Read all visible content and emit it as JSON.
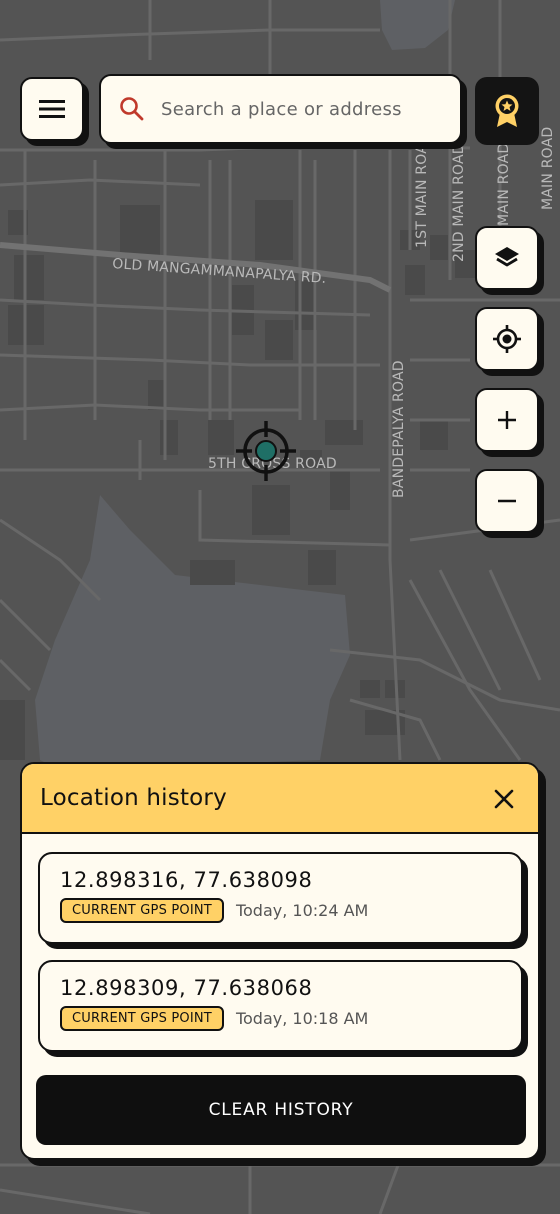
{
  "map": {
    "road_labels": {
      "old_mangammanapalya": "OLD MANGAMMANAPALYA RD.",
      "fifth_cross": "5TH CROSS ROAD",
      "bandepalya": "BANDEPALYA ROAD",
      "first_main": "1ST MAIN ROAD",
      "second_main": "2ND MAIN ROAD",
      "main_road_a": "MAIN ROAD",
      "main_road_b": "MAIN ROAD"
    }
  },
  "search": {
    "placeholder": "Search a place or address"
  },
  "icons": {
    "menu": "hamburger-menu-icon",
    "search": "search-icon",
    "badge": "award-badge-icon",
    "layers": "layers-icon",
    "locate": "locate-target-icon",
    "zoom_in": "plus-icon",
    "zoom_out": "minus-icon",
    "crosshair": "crosshair-icon",
    "close": "close-icon"
  },
  "colors": {
    "accent": "#ffd166",
    "surface": "#fffbf0",
    "ink": "#111111",
    "map_water": "#5e6064",
    "map_land": "#545454",
    "search_icon": "#c0392b",
    "crosshair_dot": "#1f6f66"
  },
  "history_panel": {
    "title": "Location history",
    "items": [
      {
        "coords": "12.898316, 77.638098",
        "tag": "CURRENT GPS POINT",
        "time": "Today, 10:24 AM"
      },
      {
        "coords": "12.898309, 77.638068",
        "tag": "CURRENT GPS POINT",
        "time": "Today, 10:18 AM"
      }
    ],
    "clear_label": "CLEAR HISTORY"
  }
}
